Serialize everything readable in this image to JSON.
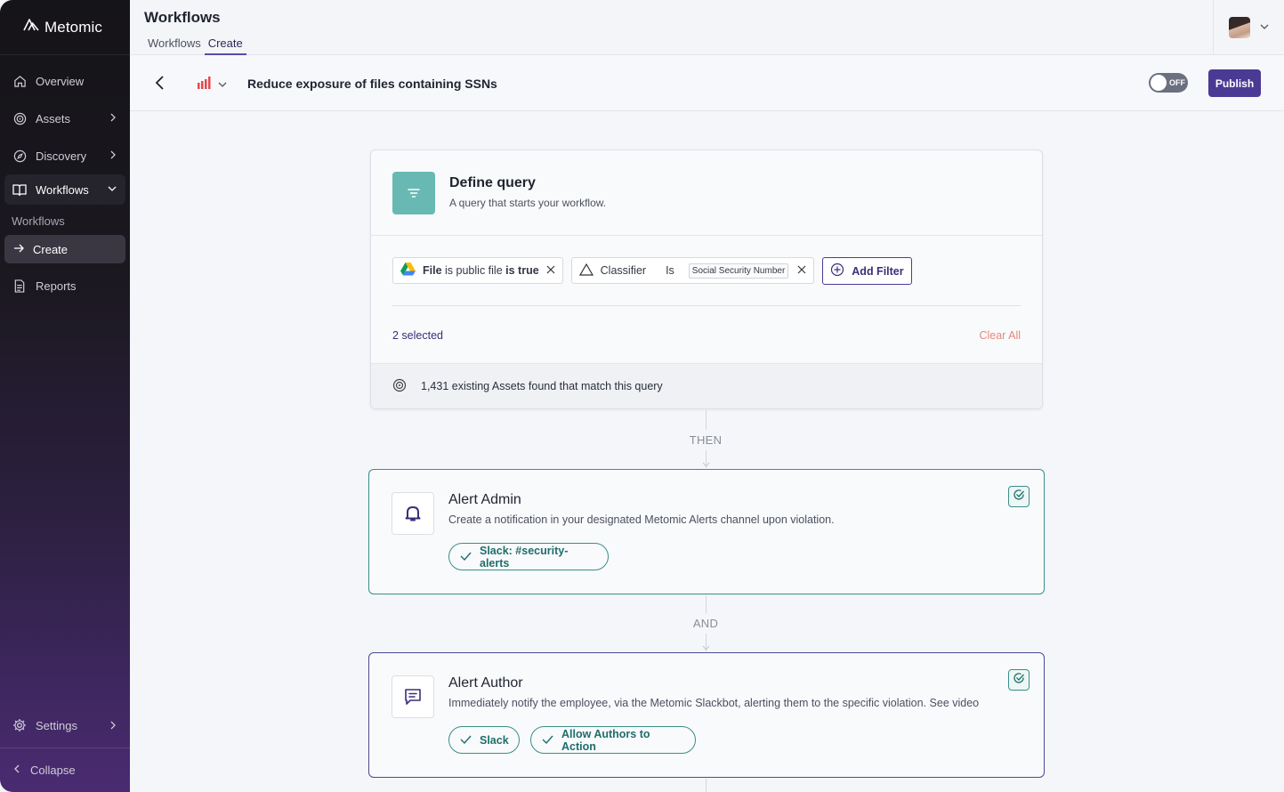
{
  "app": {
    "brand": "Metomic"
  },
  "sidebar": {
    "items": [
      {
        "label": "Overview",
        "icon": "home-icon"
      },
      {
        "label": "Assets",
        "icon": "target-icon"
      },
      {
        "label": "Discovery",
        "icon": "compass-icon"
      },
      {
        "label": "Workflows",
        "icon": "book-icon"
      },
      {
        "label": "Reports",
        "icon": "document-icon"
      }
    ],
    "workflow_sub": [
      "Workflows",
      "Create"
    ],
    "settings_label": "Settings",
    "collapse_label": "Collapse"
  },
  "topbar": {
    "title": "Workflows",
    "tabs": [
      "Workflows",
      "Create"
    ],
    "active_tab": "Create"
  },
  "workflow": {
    "title": "Reduce exposure of files containing SSNs",
    "toggle_label": "OFF",
    "toggle_on": false,
    "publish_label": "Publish",
    "severity_color": "#e5484d"
  },
  "query": {
    "title": "Define query",
    "description": "A query that starts your workflow.",
    "filter1": {
      "field": "File",
      "middle": "is public file",
      "value": "is true"
    },
    "filter2": {
      "field": "Classifier",
      "op": "Is",
      "value": "Social Security Number"
    },
    "add_filter_label": "Add Filter",
    "selected_text": "2 selected",
    "clear_label": "Clear All",
    "footer_text": "1,431 existing Assets found that match this query"
  },
  "connectors": {
    "then": "THEN",
    "and": "AND"
  },
  "actions": [
    {
      "title": "Alert Admin",
      "description": "Create a notification in your designated Metomic Alerts channel upon violation.",
      "chips": [
        "Slack: #security-alerts"
      ]
    },
    {
      "title": "Alert Author",
      "description": "Immediately notify the employee, via the Metomic Slackbot, alerting them to the specific violation. See video",
      "chips": [
        "Slack",
        "Allow Authors to Action"
      ]
    }
  ],
  "colors": {
    "accent": "#4b3a94",
    "teal": "#3a8e8a",
    "query_icon_bg": "#68b8b3"
  }
}
